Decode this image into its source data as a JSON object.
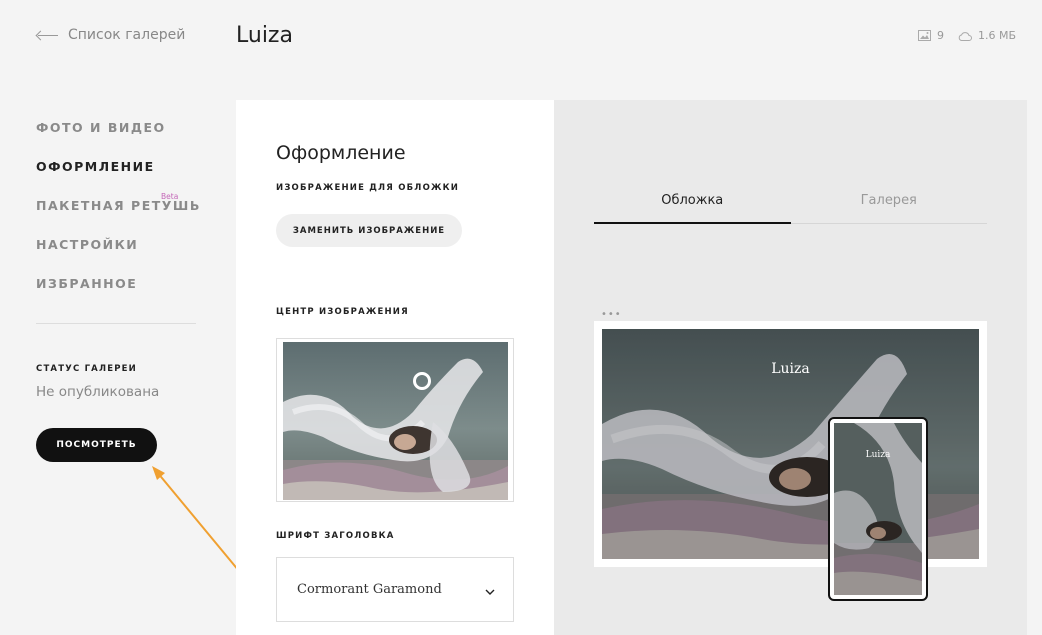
{
  "header": {
    "back_label": "Список галерей",
    "title": "Luiza",
    "photo_count": "9",
    "storage_size": "1.6 МБ"
  },
  "nav": {
    "items": [
      {
        "label": "ФОТО И ВИДЕО",
        "active": false
      },
      {
        "label": "ОФОРМЛЕНИЕ",
        "active": true
      },
      {
        "label": "ПАКЕТНАЯ РЕТУШЬ",
        "active": false,
        "badge": "Beta"
      },
      {
        "label": "НАСТРОЙКИ",
        "active": false
      },
      {
        "label": "ИЗБРАННОЕ",
        "active": false
      }
    ]
  },
  "status": {
    "label": "СТАТУС ГАЛЕРЕИ",
    "value": "Не опубликована",
    "view_button": "ПОСМОТРЕТЬ"
  },
  "design": {
    "title": "Оформление",
    "cover_label": "ИЗОБРАЖЕНИЕ ДЛЯ ОБЛОЖКИ",
    "replace_button": "ЗАМЕНИТЬ ИЗОБРАЖЕНИЕ",
    "focus_label": "ЦЕНТР ИЗОБРАЖЕНИЯ",
    "font_label": "ШРИФТ ЗАГОЛОВКА",
    "font_value": "Cormorant Garamond"
  },
  "preview": {
    "tabs": [
      {
        "label": "Обложка",
        "active": true
      },
      {
        "label": "Галерея",
        "active": false
      }
    ],
    "menu_dots": "•••",
    "cover_title": "Luiza"
  },
  "colors": {
    "annotation_arrow": "#f0a030",
    "beta_badge": "#c468b8"
  }
}
